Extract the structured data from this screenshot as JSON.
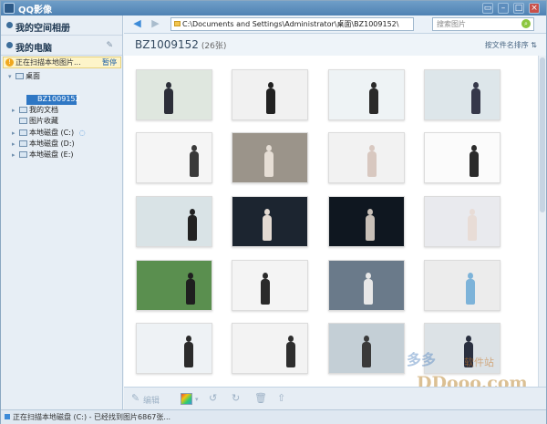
{
  "window": {
    "title": "QQ影像",
    "controls": [
      "▭",
      "–",
      "□",
      "×"
    ]
  },
  "sidebar": {
    "space_album": "我的空间相册",
    "my_computer": "我的电脑",
    "scan_text": "正在扫描本地图片...",
    "scan_pause": "暂停",
    "tree": {
      "desktop": "桌面",
      "selected": "BZ1009152",
      "documents": "我的文档",
      "favorites": "图片收藏",
      "disk_c": "本地磁盘 (C:)",
      "disk_d": "本地磁盘 (D:)",
      "disk_e": "本地磁盘 (E:)"
    }
  },
  "toolbar": {
    "path": "C:\\Documents and Settings\\Administrator\\桌面\\BZ1009152\\",
    "search_placeholder": "搜索图片"
  },
  "header": {
    "folder_name": "BZ1009152",
    "count": "(26张)",
    "sort": "按文件名排序"
  },
  "bottom": {
    "edit": "编辑"
  },
  "status": {
    "text": "正在扫描本地磁盘 (C:) - 已经找到图片6867张..."
  },
  "watermark": {
    "brand": "多多",
    "sub": "软件站",
    "url": "DDooo.com"
  },
  "colors": {
    "accent": "#2f77c4",
    "titlebar": "#4f82b3",
    "scan_bg": "#fdf4c9"
  },
  "thumbnails": [
    {
      "bg": "#dfe7df",
      "fig": "#2c2f39"
    },
    {
      "bg": "#f1f1f1",
      "fig": "#222"
    },
    {
      "bg": "#eef3f5",
      "fig": "#2a2a2a"
    },
    {
      "bg": "#dde6ea",
      "fig": "#35384a"
    },
    {
      "bg": "#f5f5f5",
      "fig": "#3a3a3a"
    },
    {
      "bg": "#9b948a",
      "fig": "#e6ded5"
    },
    {
      "bg": "#f2f2f2",
      "fig": "#d8c8c0"
    },
    {
      "bg": "#fbfbfb",
      "fig": "#2b2b2b"
    },
    {
      "bg": "#d9e3e6",
      "fig": "#222"
    },
    {
      "bg": "#1c2530",
      "fig": "#e3dad2"
    },
    {
      "bg": "#0f1720",
      "fig": "#c8c0b8"
    },
    {
      "bg": "#e9eaee",
      "fig": "#e8dcd6"
    },
    {
      "bg": "#5a8f4f",
      "fig": "#1f1f1f"
    },
    {
      "bg": "#f4f4f4",
      "fig": "#2a2a2a"
    },
    {
      "bg": "#6a7a8a",
      "fig": "#e8e8e8"
    },
    {
      "bg": "#ececec",
      "fig": "#7db3d9"
    },
    {
      "bg": "#eef2f5",
      "fig": "#2b2b2b"
    },
    {
      "bg": "#f3f3f3",
      "fig": "#2e2e2e"
    },
    {
      "bg": "#c4cfd6",
      "fig": "#3a3a3a"
    },
    {
      "bg": "#dce2e6",
      "fig": "#2a3040"
    }
  ]
}
